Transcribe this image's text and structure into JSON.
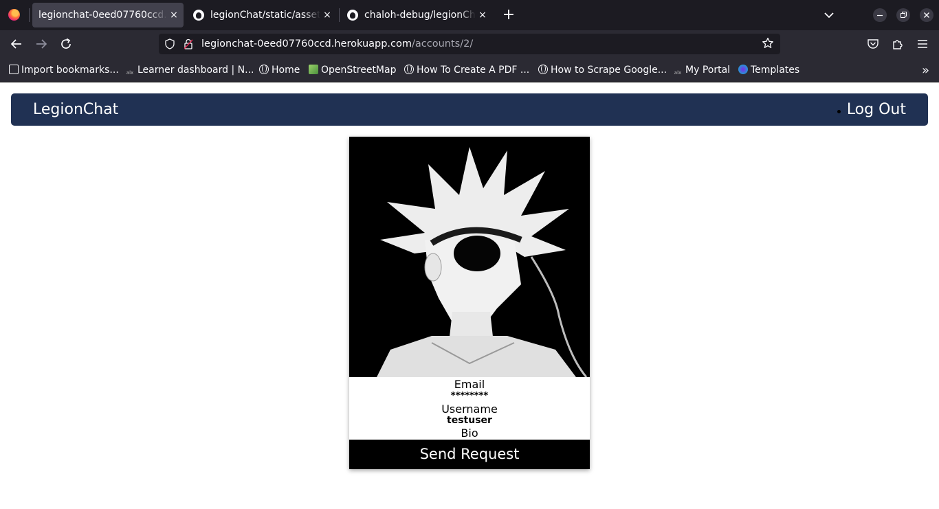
{
  "browser": {
    "tabs": [
      {
        "title": "legionchat-0eed07760ccd.herokuapp.com",
        "active": true,
        "icon": "none"
      },
      {
        "title": "legionChat/static/assets/",
        "active": false,
        "icon": "github-icon"
      },
      {
        "title": "chaloh-debug/legionChat",
        "active": false,
        "icon": "github-icon"
      }
    ],
    "new_tab": "+",
    "close_glyph": "×",
    "url_host": "legionchat-0eed07760ccd.herokuapp.com",
    "url_path": "/accounts/2/",
    "bookmarks": [
      {
        "label": "Import bookmarks...",
        "icon": "import-icon"
      },
      {
        "label": "Learner dashboard | N...",
        "icon": "alx-icon"
      },
      {
        "label": "Home",
        "icon": "globe-icon"
      },
      {
        "label": "OpenStreetMap",
        "icon": "osm-icon"
      },
      {
        "label": "How To Create A PDF ...",
        "icon": "globe-icon"
      },
      {
        "label": "How to Scrape Google...",
        "icon": "globe-icon"
      },
      {
        "label": "My Portal",
        "icon": "alx-icon"
      },
      {
        "label": "Templates",
        "icon": "canva-icon"
      }
    ],
    "bookmarks_overflow": "»"
  },
  "app": {
    "brand": "LegionChat",
    "logout": "Log Out",
    "header_color": "#203153"
  },
  "profile": {
    "email_label": "Email",
    "email_value": "********",
    "username_label": "Username",
    "username_value": "testuser",
    "bio_label": "Bio",
    "send_button": "Send Request"
  }
}
